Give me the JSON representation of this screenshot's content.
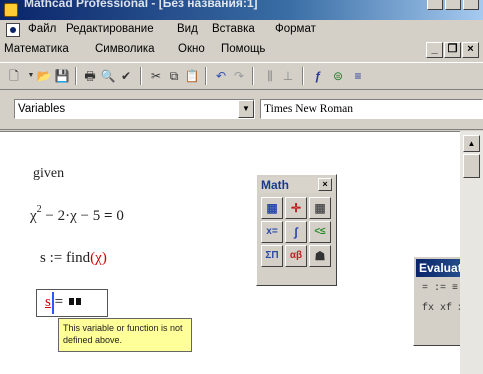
{
  "title_bar": {
    "text": "Mathcad Professional - [Без названия:1]"
  },
  "menu": {
    "row1": [
      "Файл",
      "Редактирование",
      "Вид",
      "Вставка",
      "Формат"
    ],
    "row2": [
      "Математика",
      "Символика",
      "Окно",
      "Помощь"
    ]
  },
  "mdi_buttons": {
    "minimize": "_",
    "restore": "❐",
    "close": "×"
  },
  "toolbar": {
    "icons": [
      "new-icon",
      "open-icon",
      "save-icon",
      "print-icon",
      "print-preview-icon",
      "spell-check-icon",
      "cut-icon",
      "copy-icon",
      "paste-icon",
      "undo-icon",
      "redo-icon",
      "align-icon",
      "math-toolbar-icon",
      "resource-icon",
      "calc-icon"
    ]
  },
  "format_bar": {
    "style_value": "Variables",
    "font_value": "Times New Roman"
  },
  "worksheet": {
    "given": "given",
    "equation": {
      "base1": "χ",
      "exp": "2",
      "rest": " − 2·χ − 5",
      "eq": "=",
      "rhs": "0"
    },
    "assignment": {
      "lhs": "s := find",
      "paren_open": "(",
      "arg": "χ",
      "paren_close": ")"
    },
    "eval": {
      "var": "s",
      "eq": "="
    },
    "tooltip": "This variable or function is not defined above."
  },
  "math_palette": {
    "title": "Math",
    "close": "×",
    "buttons": [
      "▦",
      "✛",
      "▦",
      "x=",
      "∫",
      "<≤",
      "ΣΠ",
      "αβ",
      "☗"
    ]
  },
  "eval_palette": {
    "title": "Evaluation",
    "row1": "=  :=  ≡",
    "row2": "fx  xf  xfy"
  },
  "colors": {
    "error_red": "#cc0000",
    "tooltip_bg": "#ffff99",
    "cursor_blue": "#3355ff",
    "title_blue": "#0a246a"
  }
}
